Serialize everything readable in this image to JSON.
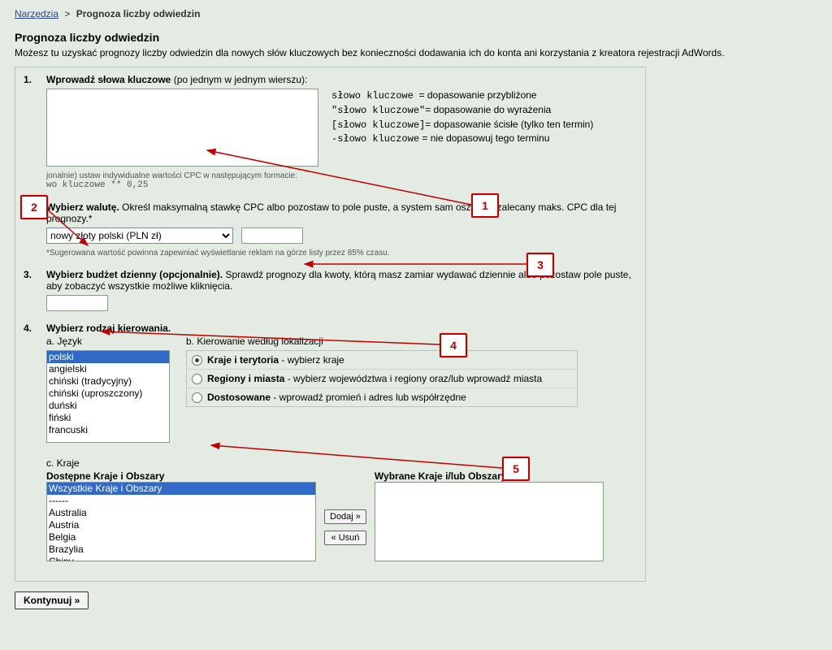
{
  "breadcrumb": {
    "root": "Narzędzia",
    "separator": ">",
    "current": "Prognoza liczby odwiedzin"
  },
  "header": {
    "title": "Prognoza liczby odwiedzin",
    "subtitle": "Możesz tu uzyskać prognozy liczby odwiedzin dla nowych słów kluczowych bez konieczności dodawania ich do konta ani korzystania z kreatora rejestracji AdWords."
  },
  "step1": {
    "num": "1.",
    "title": "Wprowadź słowa kluczowe",
    "title_suffix": " (po jednym w jednym wierszu):",
    "legend": {
      "r1_code": "słowo kluczowe",
      "r1_desc": "= dopasowanie przybliżone",
      "r2_code": "\"słowo kluczowe\"",
      "r2_desc": "= dopasowanie do wyrażenia",
      "r3_code": "[słowo kluczowe]",
      "r3_desc": "= dopasowanie ścisłe (tylko ten termin)",
      "r4_code": "-słowo kluczowe",
      "r4_desc": "= nie dopasowuj tego terminu"
    },
    "note1": "jonalnie) ustaw indywidualne wartości CPC w następującym formacie:",
    "note2": "wo kluczowe ** 0,25"
  },
  "step2": {
    "num": "2.",
    "title": "Wybierz walutę.",
    "desc": " Określ maksymalną stawkę CPC albo pozostaw to pole puste, a system sam oszacuje zalecany maks. CPC dla tej prognozy.*",
    "currency": "nowy złoty polski (PLN zł)",
    "cpc_value": "",
    "foot": "*Sugerowana wartość powinna zapewniać wyświetlanie reklam na górze listy przez 85% czasu."
  },
  "step3": {
    "num": "3.",
    "title": "Wybierz budżet dzienny (opcjonalnie).",
    "desc": " Sprawdź prognozy dla kwoty, którą masz zamiar wydawać dziennie albo pozostaw pole puste, aby zobaczyć wszystkie możliwe kliknięcia.",
    "value": ""
  },
  "step4": {
    "num": "4.",
    "title": "Wybierz rodzaj kierowania.",
    "label_a": "a. Język",
    "label_b": "b. Kierowanie według lokalizacji",
    "languages": [
      "polski",
      "angielski",
      "chiński (tradycyjny)",
      "chiński (uproszczony)",
      "duński",
      "fiński",
      "francuski"
    ],
    "lang_selected_index": 0,
    "radios": {
      "r1_title": "Kraje i terytoria",
      "r1_desc": " - wybierz kraje",
      "r2_title": "Regiony i miasta",
      "r2_desc": " - wybierz województwa i regiony oraz/lub wprowadź miasta",
      "r3_title": "Dostosowane",
      "r3_desc": " - wprowadź promień i adres lub współrzędne"
    },
    "label_c": "c. Kraje",
    "available_title": "Dostępne Kraje i Obszary",
    "selected_title": "Wybrane Kraje i/lub Obszary",
    "available": [
      "Wszystkie Kraje i Obszary",
      "------",
      "Australia",
      "Austria",
      "Belgia",
      "Brazylia",
      "Chiny"
    ],
    "available_selected_index": 0,
    "add_btn": "Dodaj »",
    "remove_btn": "« Usuń"
  },
  "continue_label": "Kontynuuj  »",
  "annotations": {
    "b1": "1",
    "b2": "2",
    "b3": "3",
    "b4": "4",
    "b5": "5"
  }
}
